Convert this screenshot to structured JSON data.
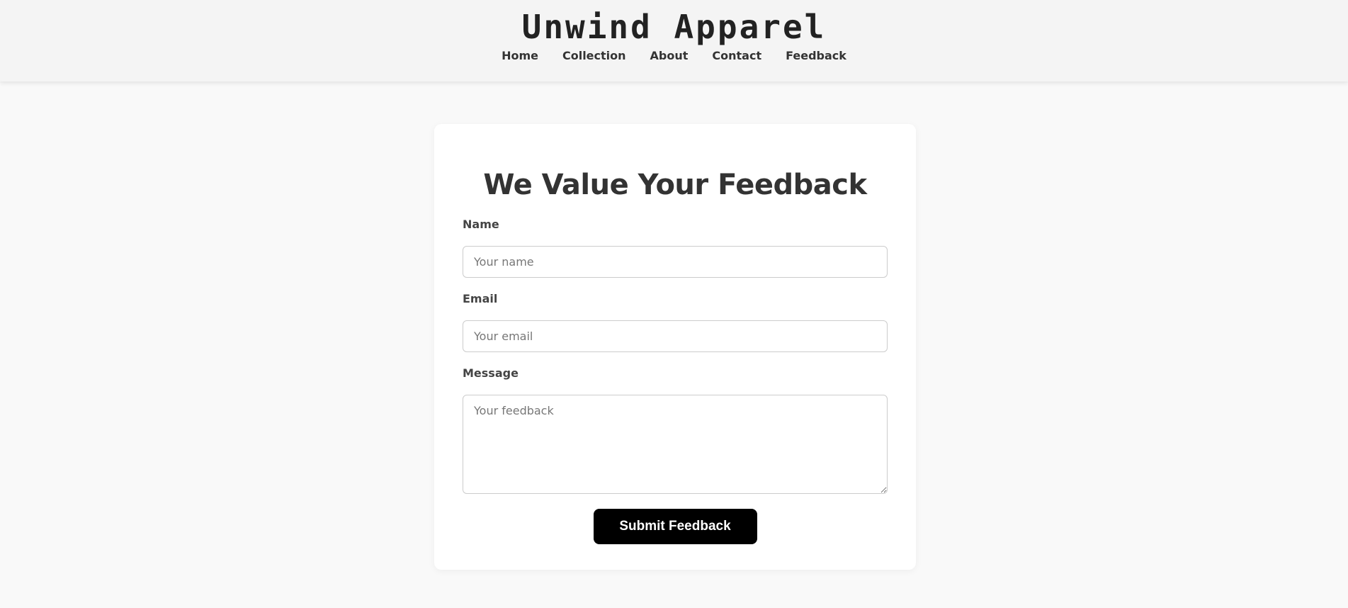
{
  "header": {
    "logo_text": "Unwind Apparel",
    "nav": [
      {
        "label": "Home"
      },
      {
        "label": "Collection"
      },
      {
        "label": "About"
      },
      {
        "label": "Contact"
      },
      {
        "label": "Feedback"
      }
    ]
  },
  "form": {
    "title": "We Value Your Feedback",
    "fields": {
      "name": {
        "label": "Name",
        "placeholder": "Your name",
        "value": ""
      },
      "email": {
        "label": "Email",
        "placeholder": "Your email",
        "value": ""
      },
      "message": {
        "label": "Message",
        "placeholder": "Your feedback",
        "value": ""
      }
    },
    "submit_label": "Submit Feedback"
  },
  "colors": {
    "page_background": "#f9f9f9",
    "header_background": "#f4f4f4",
    "card_background": "#ffffff",
    "text": "#333333",
    "button_background": "#000000",
    "button_text": "#ffffff",
    "input_border": "#cccccc"
  }
}
